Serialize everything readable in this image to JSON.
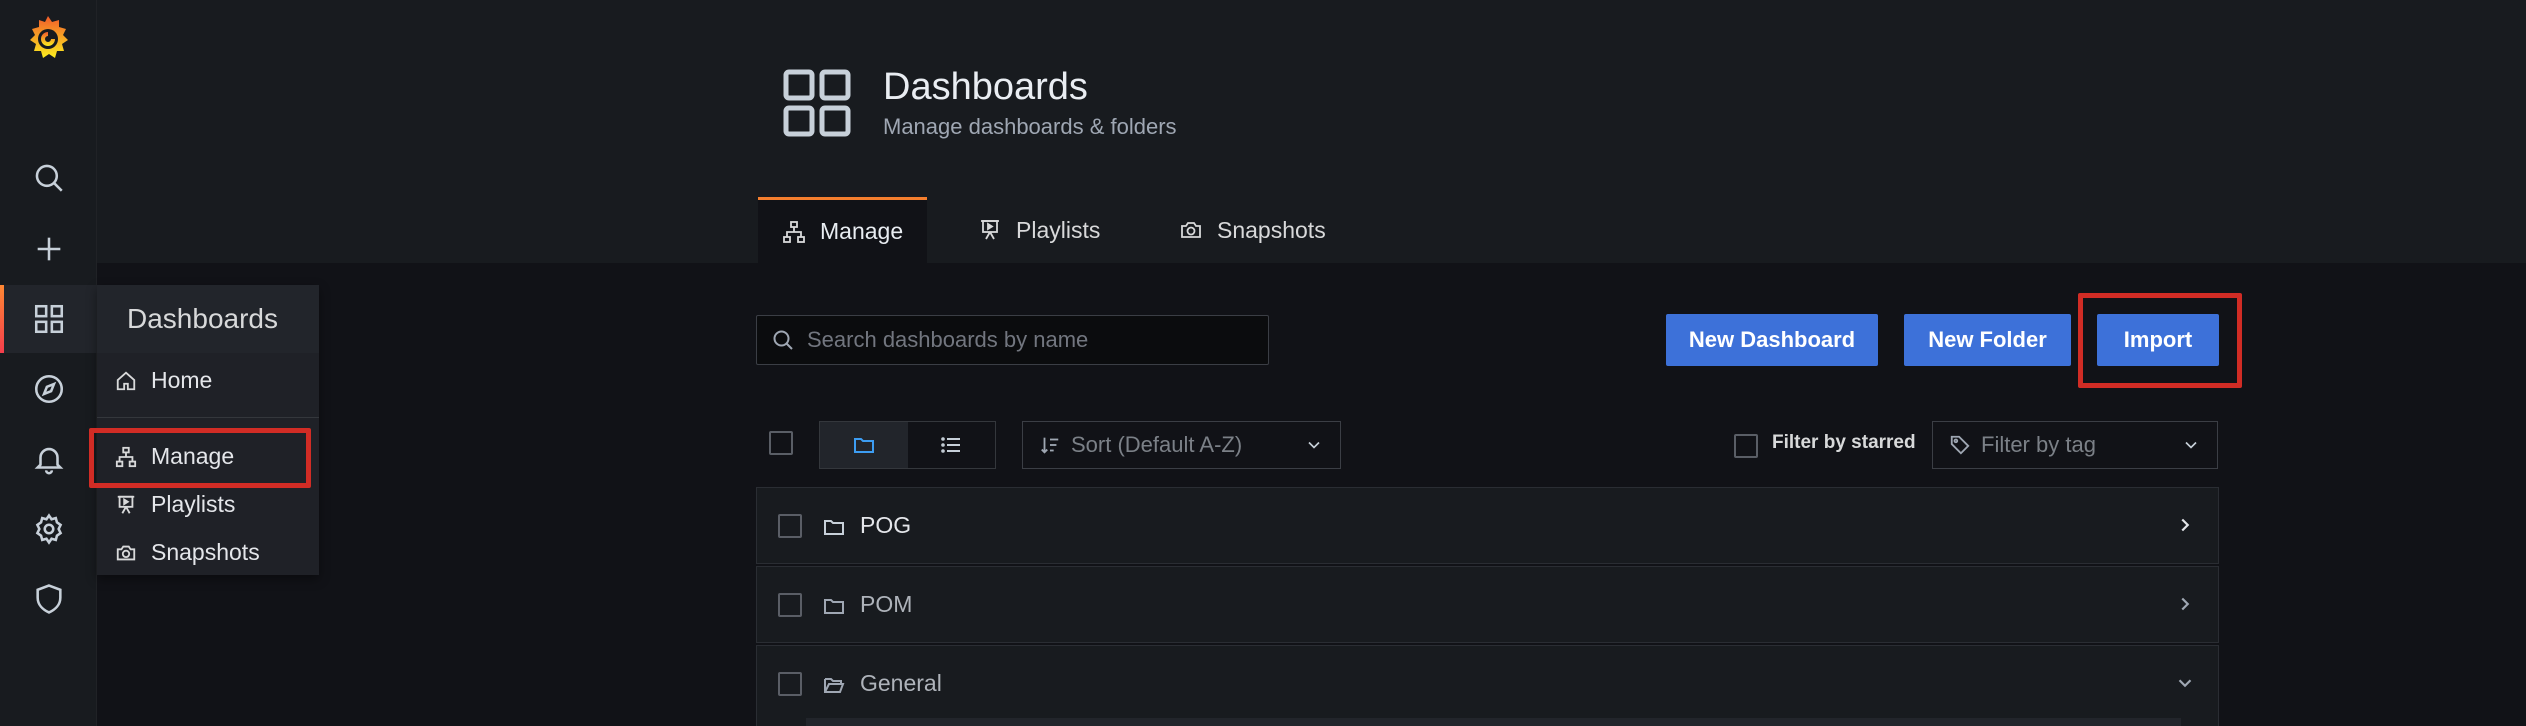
{
  "sidebar": {
    "icons": [
      "grafana-logo",
      "search-icon",
      "plus-icon",
      "dashboards-icon",
      "explore-icon",
      "alerting-bell-icon",
      "settings-gear-icon",
      "shield-icon"
    ],
    "flyout": {
      "title": "Dashboards",
      "items": [
        {
          "label": "Home",
          "icon": "home-icon"
        },
        {
          "label": "Manage",
          "icon": "sitemap-icon"
        },
        {
          "label": "Playlists",
          "icon": "presentation-icon"
        },
        {
          "label": "Snapshots",
          "icon": "camera-icon"
        }
      ]
    }
  },
  "header": {
    "title": "Dashboards",
    "subtitle": "Manage dashboards & folders",
    "tabs": [
      {
        "label": "Manage",
        "icon": "sitemap-icon",
        "active": true
      },
      {
        "label": "Playlists",
        "icon": "presentation-icon",
        "active": false
      },
      {
        "label": "Snapshots",
        "icon": "camera-icon",
        "active": false
      }
    ]
  },
  "toolbar": {
    "search_placeholder": "Search dashboards by name",
    "new_dashboard": "New Dashboard",
    "new_folder": "New Folder",
    "import": "Import"
  },
  "filters": {
    "sort_placeholder": "Sort (Default A-Z)",
    "starred_label": "Filter by starred",
    "tag_placeholder": "Filter by tag"
  },
  "folders": [
    {
      "name": "POG",
      "expanded": false
    },
    {
      "name": "POM",
      "expanded": false
    },
    {
      "name": "General",
      "expanded": true
    }
  ],
  "colors": {
    "accent": "#f57f2e",
    "primary_button": "#3d71d9",
    "highlight": "#d12c25"
  }
}
